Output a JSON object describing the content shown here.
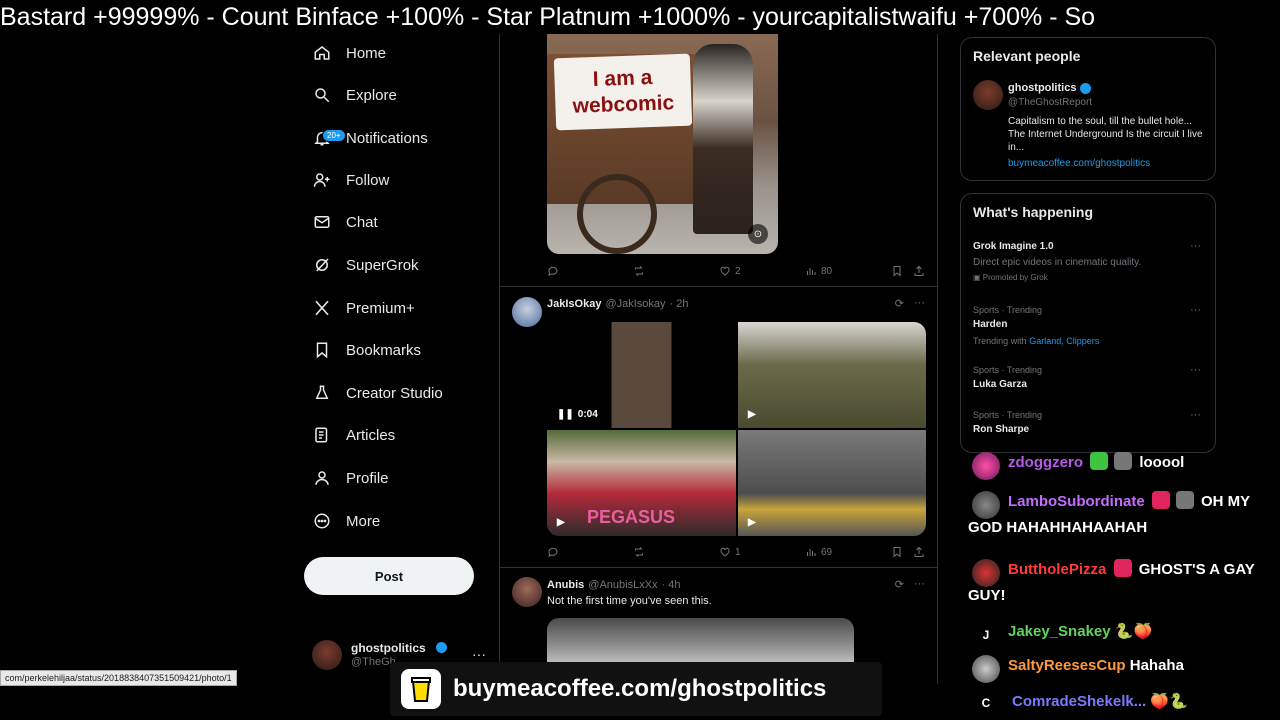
{
  "ticker": {
    "text": "Bastard +99999% - Count Binface +100%  -  Star Platnum +1000%   -   yourcapitalistwaifu +700%  -  So"
  },
  "nav": {
    "items": [
      {
        "label": "Home",
        "icon": "home-icon"
      },
      {
        "label": "Explore",
        "icon": "search-icon"
      },
      {
        "label": "Notifications",
        "icon": "bell-icon",
        "badge": "20+"
      },
      {
        "label": "Follow",
        "icon": "person-add-icon"
      },
      {
        "label": "Chat",
        "icon": "mail-icon"
      },
      {
        "label": "SuperGrok",
        "icon": "grok-icon"
      },
      {
        "label": "Premium+",
        "icon": "x-logo-icon"
      },
      {
        "label": "Bookmarks",
        "icon": "bookmark-icon"
      },
      {
        "label": "Creator Studio",
        "icon": "flask-icon"
      },
      {
        "label": "Articles",
        "icon": "article-icon"
      },
      {
        "label": "Profile",
        "icon": "person-icon"
      },
      {
        "label": "More",
        "icon": "more-circle-icon"
      }
    ],
    "post_label": "Post",
    "account": {
      "name": "ghostpolitics",
      "handle": "@TheGh",
      "dots": "···"
    }
  },
  "feed": {
    "tweet1": {
      "sign_line1": "I am a",
      "sign_line2": "webcomic",
      "likes": "2",
      "views": "80"
    },
    "tweet2": {
      "name": "JakIsOkay",
      "handle": "@JakIsokay",
      "time": "· 2h",
      "video_time": "0:04",
      "shirt": "PEGASUS",
      "likes": "1",
      "views": "69"
    },
    "tweet3": {
      "name": "Anubis",
      "handle": "@AnubisLxXx",
      "time": "· 4h",
      "text": "Not the first time you've seen this."
    }
  },
  "right": {
    "relevant": {
      "title": "Relevant people",
      "name": "ghostpolitics",
      "handle": "@TheGhostReport",
      "bio": "Capitalism to the soul, till the bullet hole... The Internet Underground Is the circuit I live in...",
      "link": "buymeacoffee.com/ghostpolitics"
    },
    "happening": {
      "title": "What's happening",
      "promo_title": "Grok Imagine 1.0",
      "promo_desc": "Direct epic videos in cinematic quality.",
      "promo_by": "Promoted by Grok",
      "trends": [
        {
          "context": "Sports · Trending",
          "name": "Harden",
          "with_prefix": "Trending with",
          "with": "Garland, Clippers"
        },
        {
          "context": "Sports · Trending",
          "name": "Luka Garza"
        },
        {
          "context": "Sports · Trending",
          "name": "Ron Sharpe"
        }
      ]
    }
  },
  "chat": [
    {
      "user": "zdoggzero",
      "color": "#b45ae6",
      "text": "looool"
    },
    {
      "user": "LamboSubordinate",
      "color": "#c46cff",
      "text": "OH MY GOD HAHAHHAHAAHAH"
    },
    {
      "user": "ButtholePizza",
      "color": "#ff3b3b",
      "text": "GHOST'S A GAY GUY!"
    },
    {
      "user": "Jakey_Snakey",
      "color": "#5fd35f",
      "text": "",
      "initial": "J"
    },
    {
      "user": "SaltyReesesCup",
      "color": "#ff9a3c",
      "text": "Hahaha"
    },
    {
      "user": "ComradeShekelk...",
      "color": "#7a7aff",
      "text": "",
      "initial": "C"
    }
  ],
  "status_url": "com/perkelehiljaa/status/2018838407351509421/photo/1",
  "banner": {
    "text": "buymeacoffee.com/ghostpolitics"
  }
}
